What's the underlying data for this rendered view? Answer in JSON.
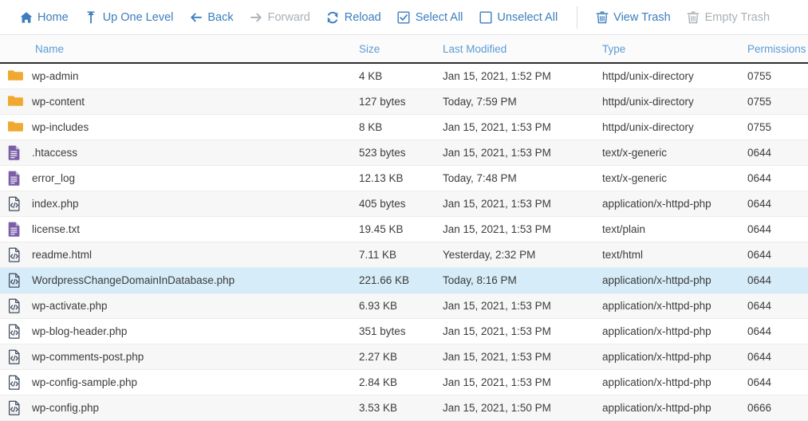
{
  "toolbar": {
    "items": [
      {
        "label": "Home",
        "icon": "home-icon",
        "enabled": true,
        "name": "toolbar-home"
      },
      {
        "label": "Up One Level",
        "icon": "arrow-up-icon",
        "enabled": true,
        "name": "toolbar-up-one-level"
      },
      {
        "label": "Back",
        "icon": "arrow-left-icon",
        "enabled": true,
        "name": "toolbar-back"
      },
      {
        "label": "Forward",
        "icon": "arrow-right-icon",
        "enabled": false,
        "name": "toolbar-forward"
      },
      {
        "label": "Reload",
        "icon": "reload-icon",
        "enabled": true,
        "name": "toolbar-reload"
      },
      {
        "label": "Select All",
        "icon": "checkbox-checked-icon",
        "enabled": true,
        "name": "toolbar-select-all"
      },
      {
        "label": "Unselect All",
        "icon": "checkbox-empty-icon",
        "enabled": true,
        "name": "toolbar-unselect-all"
      },
      {
        "label": "View Trash",
        "icon": "trash-icon",
        "enabled": true,
        "name": "toolbar-view-trash"
      },
      {
        "label": "Empty Trash",
        "icon": "trash-icon",
        "enabled": false,
        "name": "toolbar-empty-trash"
      }
    ],
    "separator_after_index": 6
  },
  "colors": {
    "link": "#3b7dbd",
    "disabled": "#a9b0b6",
    "header_text": "#5b9bd5",
    "selected_row": "#d6ecf8",
    "folder_icon": "#f0a830",
    "text_file_icon": "#7b5ea7",
    "code_file_icon": "#3d4a5c"
  },
  "table": {
    "columns": [
      {
        "label": "Name",
        "key": "name"
      },
      {
        "label": "Size",
        "key": "size"
      },
      {
        "label": "Last Modified",
        "key": "modified"
      },
      {
        "label": "Type",
        "key": "type"
      },
      {
        "label": "Permissions",
        "key": "permissions"
      }
    ],
    "rows": [
      {
        "name": "wp-admin",
        "size": "4 KB",
        "modified": "Jan 15, 2021, 1:52 PM",
        "type": "httpd/unix-directory",
        "permissions": "0755",
        "icon": "folder-icon",
        "selected": false
      },
      {
        "name": "wp-content",
        "size": "127 bytes",
        "modified": "Today, 7:59 PM",
        "type": "httpd/unix-directory",
        "permissions": "0755",
        "icon": "folder-icon",
        "selected": false
      },
      {
        "name": "wp-includes",
        "size": "8 KB",
        "modified": "Jan 15, 2021, 1:53 PM",
        "type": "httpd/unix-directory",
        "permissions": "0755",
        "icon": "folder-icon",
        "selected": false
      },
      {
        "name": ".htaccess",
        "size": "523 bytes",
        "modified": "Jan 15, 2021, 1:53 PM",
        "type": "text/x-generic",
        "permissions": "0644",
        "icon": "text-file-icon",
        "selected": false
      },
      {
        "name": "error_log",
        "size": "12.13 KB",
        "modified": "Today, 7:48 PM",
        "type": "text/x-generic",
        "permissions": "0644",
        "icon": "text-file-icon",
        "selected": false
      },
      {
        "name": "index.php",
        "size": "405 bytes",
        "modified": "Jan 15, 2021, 1:53 PM",
        "type": "application/x-httpd-php",
        "permissions": "0644",
        "icon": "code-file-icon",
        "selected": false
      },
      {
        "name": "license.txt",
        "size": "19.45 KB",
        "modified": "Jan 15, 2021, 1:53 PM",
        "type": "text/plain",
        "permissions": "0644",
        "icon": "text-file-icon",
        "selected": false
      },
      {
        "name": "readme.html",
        "size": "7.11 KB",
        "modified": "Yesterday, 2:32 PM",
        "type": "text/html",
        "permissions": "0644",
        "icon": "code-file-icon",
        "selected": false
      },
      {
        "name": "WordpressChangeDomainInDatabase.php",
        "size": "221.66 KB",
        "modified": "Today, 8:16 PM",
        "type": "application/x-httpd-php",
        "permissions": "0644",
        "icon": "code-file-icon",
        "selected": true
      },
      {
        "name": "wp-activate.php",
        "size": "6.93 KB",
        "modified": "Jan 15, 2021, 1:53 PM",
        "type": "application/x-httpd-php",
        "permissions": "0644",
        "icon": "code-file-icon",
        "selected": false
      },
      {
        "name": "wp-blog-header.php",
        "size": "351 bytes",
        "modified": "Jan 15, 2021, 1:53 PM",
        "type": "application/x-httpd-php",
        "permissions": "0644",
        "icon": "code-file-icon",
        "selected": false
      },
      {
        "name": "wp-comments-post.php",
        "size": "2.27 KB",
        "modified": "Jan 15, 2021, 1:53 PM",
        "type": "application/x-httpd-php",
        "permissions": "0644",
        "icon": "code-file-icon",
        "selected": false
      },
      {
        "name": "wp-config-sample.php",
        "size": "2.84 KB",
        "modified": "Jan 15, 2021, 1:53 PM",
        "type": "application/x-httpd-php",
        "permissions": "0644",
        "icon": "code-file-icon",
        "selected": false
      },
      {
        "name": "wp-config.php",
        "size": "3.53 KB",
        "modified": "Jan 15, 2021, 1:50 PM",
        "type": "application/x-httpd-php",
        "permissions": "0666",
        "icon": "code-file-icon",
        "selected": false
      }
    ]
  }
}
